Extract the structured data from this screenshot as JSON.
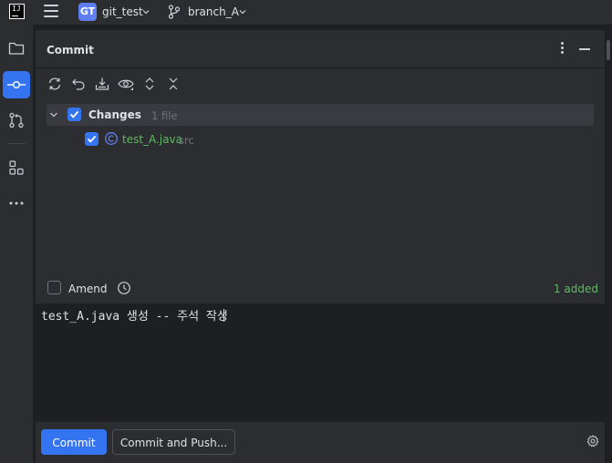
{
  "topbar": {
    "logo_text": "IJ",
    "project_badge": "GT",
    "project_name": "git_test",
    "branch_name": "branch_A"
  },
  "toolstrip": {
    "items": [
      {
        "icon": "folder-icon"
      },
      {
        "icon": "commit-icon",
        "active": true
      },
      {
        "icon": "pull-request-icon"
      },
      {
        "icon": "structure-icon"
      },
      {
        "icon": "more-icon"
      }
    ]
  },
  "commit_panel": {
    "title": "Commit",
    "toolbar_icons": [
      "refresh-icon",
      "rollback-icon",
      "shelve-icon",
      "preview-diff-icon",
      "expand-all-icon",
      "collapse-all-icon"
    ],
    "changes": {
      "label": "Changes",
      "count": "1 file",
      "checked": true,
      "files": [
        {
          "name": "test_A.java",
          "dir": "src",
          "checked": true,
          "type_icon": "java-class-icon"
        }
      ]
    },
    "amend_label": "Amend",
    "added_status": "1 added",
    "message": "test_A.java 생성 -- 주석 작성",
    "commit_label": "Commit",
    "commit_push_label": "Commit and Push...",
    "accent_color": "#3574f0",
    "added_color": "#5fb865"
  }
}
